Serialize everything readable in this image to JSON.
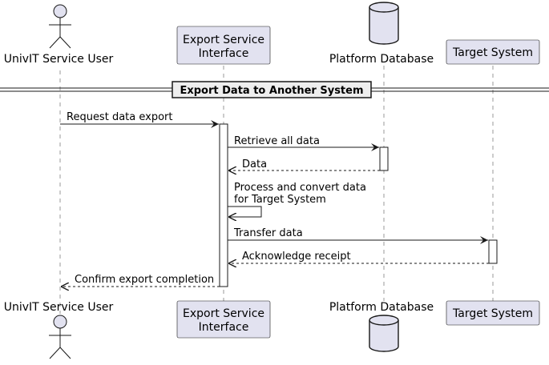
{
  "participants": {
    "user": {
      "label": "UnivIT Service User"
    },
    "service": {
      "label_line1": "Export Service",
      "label_line2": "Interface"
    },
    "database": {
      "label": "Platform Database"
    },
    "target": {
      "label": "Target System"
    }
  },
  "group": {
    "title": "Export Data to Another System"
  },
  "messages": {
    "m1": "Request data export",
    "m2": "Retrieve all data",
    "m3": "Data",
    "m4_line1": "Process and convert data",
    "m4_line2": "for Target System",
    "m5": "Transfer data",
    "m6": "Acknowledge receipt",
    "m7": "Confirm export completion"
  },
  "colors": {
    "participant_fill": "#E2E2F0",
    "line": "#181818",
    "lifeline": "#7F7F7F",
    "group_fill": "#EEEEEE"
  }
}
